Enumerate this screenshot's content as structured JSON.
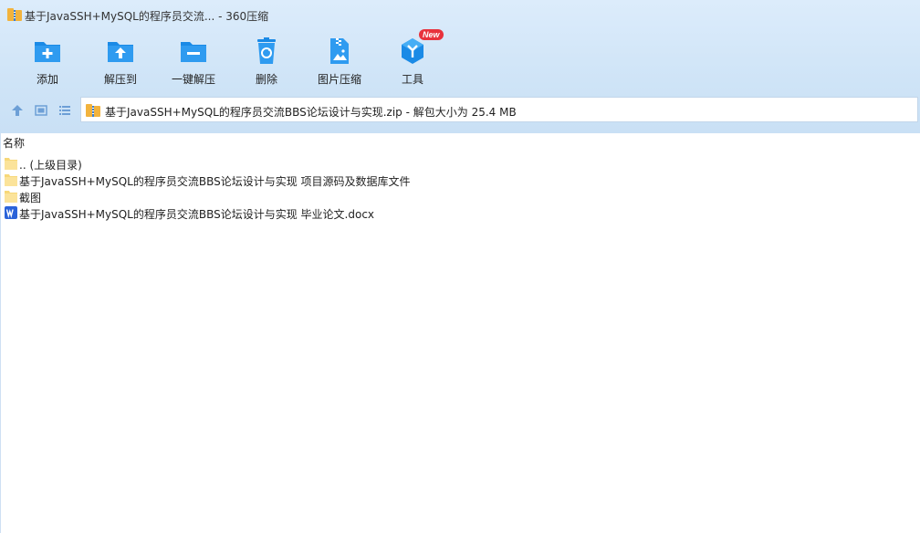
{
  "window": {
    "title": "基于JavaSSH+MySQL的程序员交流... - 360压缩"
  },
  "toolbar": {
    "items": [
      {
        "label": "添加",
        "icon": "add-folder-icon"
      },
      {
        "label": "解压到",
        "icon": "extract-to-icon"
      },
      {
        "label": "一键解压",
        "icon": "one-click-extract-icon"
      },
      {
        "label": "删除",
        "icon": "recycle-bin-icon"
      },
      {
        "label": "图片压缩",
        "icon": "image-compress-icon"
      },
      {
        "label": "工具",
        "icon": "tools-icon",
        "badge": "New"
      }
    ]
  },
  "nav": {
    "address": "基于JavaSSH+MySQL的程序员交流BBS论坛设计与实现.zip - 解包大小为 25.4 MB"
  },
  "filelist": {
    "column_name": "名称",
    "rows": [
      {
        "name": ".. (上级目录)",
        "type": "folder"
      },
      {
        "name": "基于JavaSSH+MySQL的程序员交流BBS论坛设计与实现 项目源码及数据库文件",
        "type": "folder"
      },
      {
        "name": "截图",
        "type": "folder"
      },
      {
        "name": "基于JavaSSH+MySQL的程序员交流BBS论坛设计与实现 毕业论文.docx",
        "type": "word"
      }
    ]
  },
  "colors": {
    "accent": "#1a8ae6",
    "folder": "#f7d879",
    "word": "#2b63d9",
    "badge": "#e8323c"
  }
}
